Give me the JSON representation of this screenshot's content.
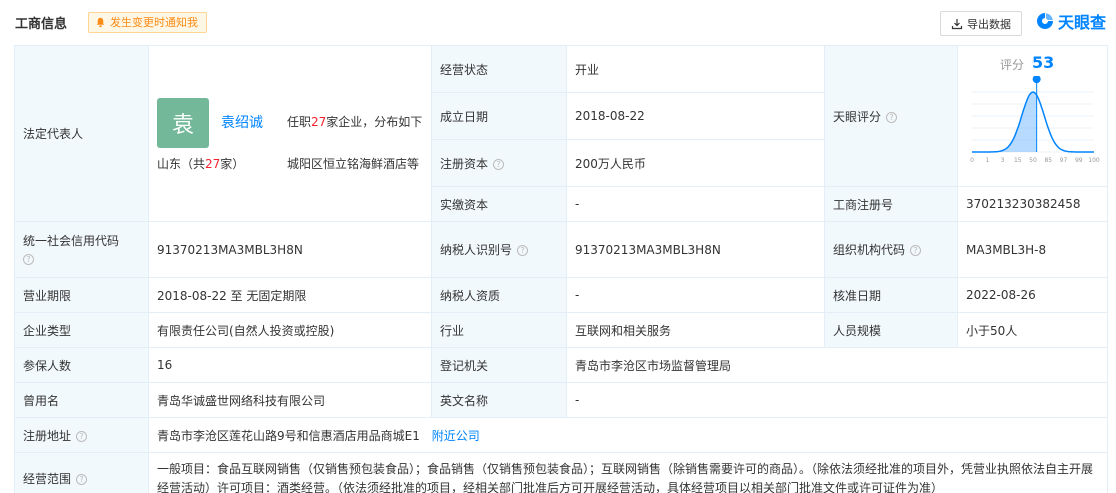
{
  "header": {
    "title": "工商信息",
    "notify_label": "发生变更时通知我",
    "export_label": "导出数据",
    "logo_text": "天眼查",
    "accent": "#0084ff"
  },
  "rep": {
    "label": "法定代表人",
    "avatar_char": "袁",
    "name": "袁绍诚",
    "office_prefix": "任职",
    "office_count": "27",
    "office_suffix": "家企业，分布如下",
    "region_prefix": "山东（共",
    "region_count": "27",
    "region_suffix": "家）",
    "company": "城阳区恒立铭海鲜酒店等"
  },
  "status": {
    "label": "经营状态",
    "value": "开业"
  },
  "established": {
    "label": "成立日期",
    "value": "2018-08-22"
  },
  "reg_capital": {
    "label": "注册资本",
    "value": "200万人民币"
  },
  "paid_capital": {
    "label": "实缴资本",
    "value": "-"
  },
  "tianyan": {
    "label": "天眼评分",
    "score_label": "评分",
    "score": 53,
    "ticks": [
      "0",
      "1",
      "3",
      "15",
      "50",
      "85",
      "97",
      "99",
      "100"
    ]
  },
  "biz_reg_no": {
    "label": "工商注册号",
    "value": "370213230382458"
  },
  "credit_code": {
    "label": "统一社会信用代码",
    "value": "91370213MA3MBL3H8N"
  },
  "taxpayer_id": {
    "label": "纳税人识别号",
    "value": "91370213MA3MBL3H8N"
  },
  "org_code": {
    "label": "组织机构代码",
    "value": "MA3MBL3H-8"
  },
  "term": {
    "label": "营业期限",
    "value": "2018-08-22 至 无固定期限"
  },
  "taxpayer_qual": {
    "label": "纳税人资质",
    "value": "-"
  },
  "approval_date": {
    "label": "核准日期",
    "value": "2022-08-26"
  },
  "company_type": {
    "label": "企业类型",
    "value": "有限责任公司(自然人投资或控股)"
  },
  "industry": {
    "label": "行业",
    "value": "互联网和相关服务"
  },
  "staff_size": {
    "label": "人员规模",
    "value": "小于50人"
  },
  "insured": {
    "label": "参保人数",
    "value": "16"
  },
  "authority": {
    "label": "登记机关",
    "value": "青岛市李沧区市场监督管理局"
  },
  "former_name": {
    "label": "曾用名",
    "value": "青岛华诚盛世网络科技有限公司"
  },
  "english_name": {
    "label": "英文名称",
    "value": "-"
  },
  "address": {
    "label": "注册地址",
    "value": "青岛市李沧区莲花山路9号和信惠酒店用品商城E1",
    "link": "附近公司"
  },
  "scope": {
    "label": "经营范围",
    "value": "一般项目：食品互联网销售（仅销售预包装食品）；食品销售（仅销售预包装食品）；互联网销售（除销售需要许可的商品）。（除依法须经批准的项目外，凭营业执照依法自主开展经营活动）许可项目：酒类经营。（依法须经批准的项目，经相关部门批准后方可开展经营活动，具体经营项目以相关部门批准文件或许可证件为准）"
  }
}
